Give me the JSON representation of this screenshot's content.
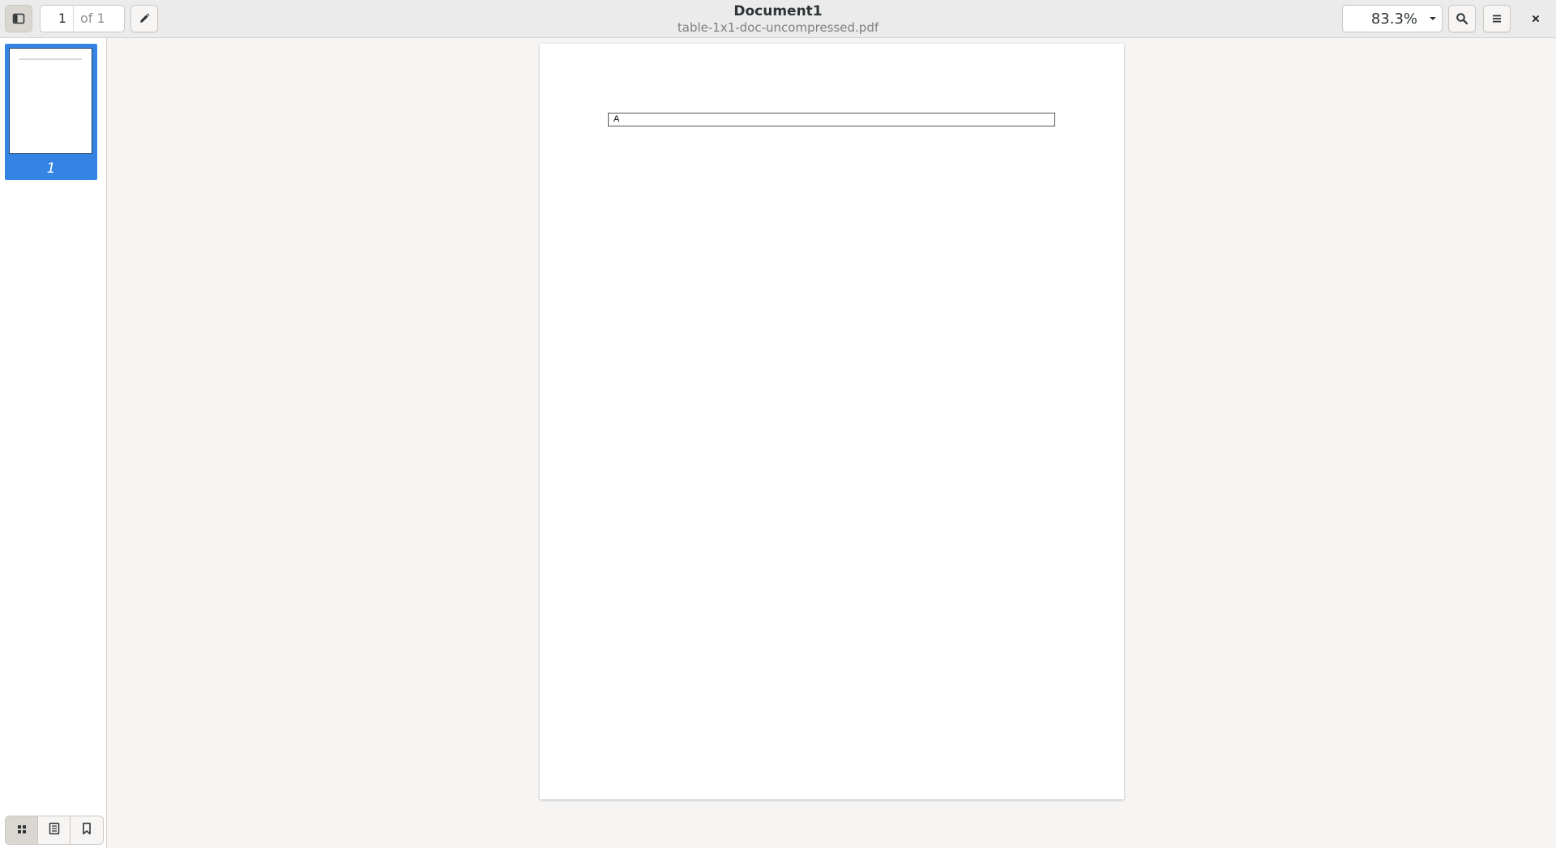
{
  "header": {
    "title": "Document1",
    "subtitle": "table-1x1-doc-uncompressed.pdf",
    "page_number": "1",
    "page_total": "of 1",
    "zoom": "83.3%",
    "icons": {
      "sidebar_toggle": "sidebar-toggle-icon",
      "annotate": "pencil-icon",
      "search": "search-icon",
      "menu": "hamburger-menu-icon",
      "close": "close-icon"
    }
  },
  "sidebar": {
    "thumbnails": [
      {
        "label": "1",
        "selected": true
      }
    ],
    "switcher": [
      {
        "name": "thumbnails",
        "icon": "grid-icon",
        "active": true
      },
      {
        "name": "outline",
        "icon": "document-list-icon",
        "active": false
      },
      {
        "name": "bookmarks",
        "icon": "bookmark-icon",
        "active": false
      }
    ]
  },
  "document": {
    "table": {
      "rows": [
        [
          "A"
        ]
      ]
    }
  },
  "colors": {
    "accent": "#3584e4",
    "headerbar": "#ebebeb",
    "background": "#f6f5f4"
  }
}
